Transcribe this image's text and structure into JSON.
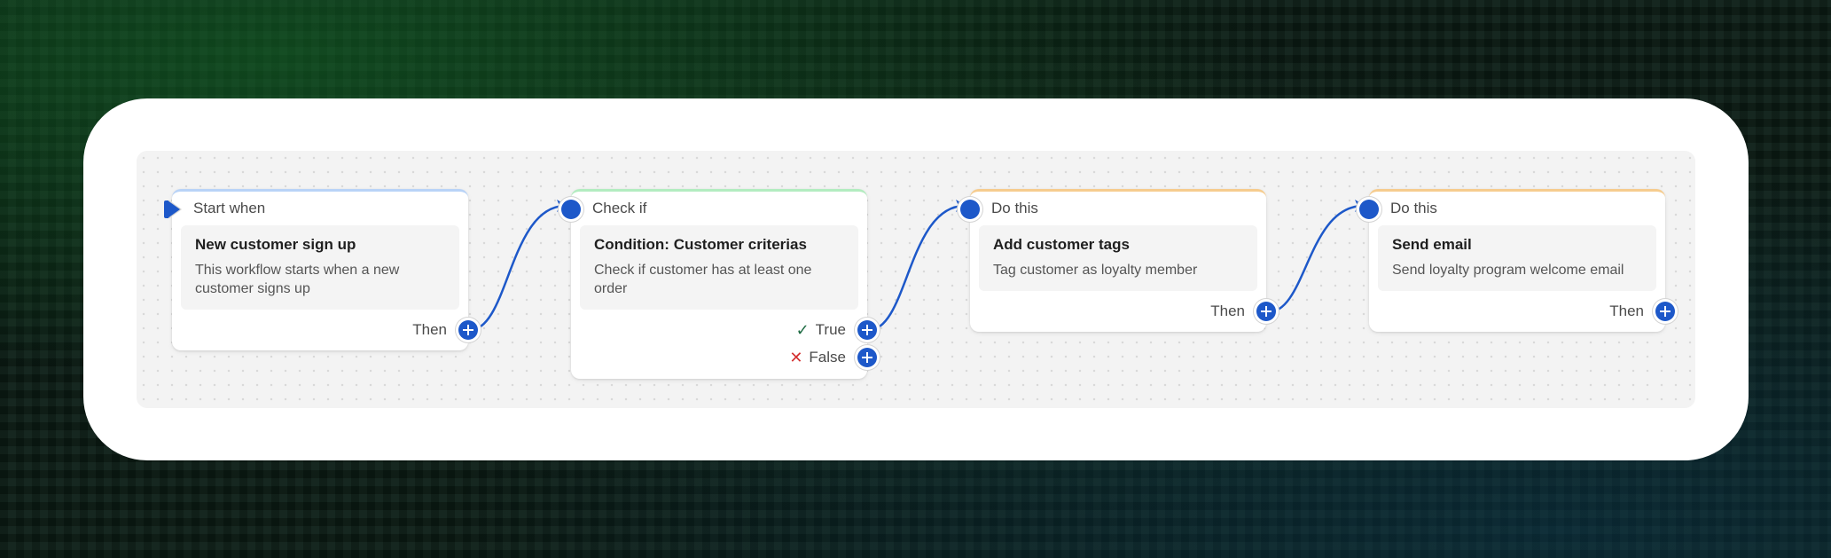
{
  "colors": {
    "accent": "#1d58c9",
    "canvas": "#f3f3f3",
    "start_border": "#b9d3f7",
    "condition_border": "#b3ecc0",
    "action_border": "#f6cc8e",
    "true_icon": "#1e6b43",
    "false_icon": "#d43131"
  },
  "nodes": [
    {
      "header": "Start when",
      "title": "New customer sign up",
      "description": "This workflow starts when a new customer signs up",
      "outputs": [
        {
          "label": "Then",
          "icon": "plus-icon"
        }
      ]
    },
    {
      "header": "Check if",
      "title": "Condition: Customer criterias",
      "description": "Check if customer has at least one order",
      "outputs": [
        {
          "label": "True",
          "icon": "check-icon"
        },
        {
          "label": "False",
          "icon": "x-icon"
        }
      ]
    },
    {
      "header": "Do this",
      "title": "Add customer tags",
      "description": "Tag customer as loyalty member",
      "outputs": [
        {
          "label": "Then",
          "icon": "plus-icon"
        }
      ]
    },
    {
      "header": "Do this",
      "title": "Send email",
      "description": "Send loyalty program welcome email",
      "outputs": [
        {
          "label": "Then",
          "icon": "plus-icon"
        }
      ]
    }
  ],
  "icons": {
    "check": "✓",
    "x": "✕"
  }
}
